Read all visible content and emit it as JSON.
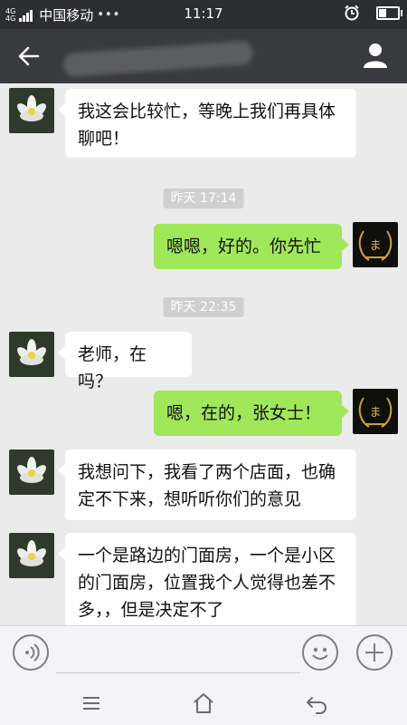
{
  "status_bar": {
    "network_top": "4G",
    "network_bottom": "4G",
    "carrier": "中国移动",
    "dots": "•••",
    "time": "11:17"
  },
  "header": {
    "title": "",
    "back_icon": "arrow-left-icon",
    "profile_icon": "person-icon"
  },
  "messages": [
    {
      "side": "in",
      "text": "我这会比较忙，等晚上我们再具体聊吧！"
    },
    {
      "type": "timestamp",
      "text": "昨天 17:14"
    },
    {
      "side": "out",
      "text": "嗯嗯，好的。你先忙"
    },
    {
      "type": "timestamp",
      "text": "昨天 22:35"
    },
    {
      "side": "in",
      "text": "老师，在吗？"
    },
    {
      "side": "out",
      "text": "嗯，在的，张女士！"
    },
    {
      "side": "in",
      "text": "我想问下，我看了两个店面，也确定不下来，想听听你们的意见"
    },
    {
      "side": "in",
      "text": "一个是路边的门面房，一个是小区的门面房，位置我个人觉得也差不多，，但是决定不了"
    }
  ],
  "colors": {
    "title_bar": "#393a3f",
    "status_bar": "#2d2e32",
    "chat_bg": "#ebebeb",
    "bubble_out": "#a0e75a",
    "bubble_in": "#ffffff"
  },
  "input_bar": {
    "voice_icon": "voice-icon",
    "emoji_icon": "emoji-icon",
    "plus_icon": "plus-icon"
  },
  "nav_bar": {
    "menu_icon": "menu-icon",
    "home_icon": "home-icon",
    "back_icon": "back-icon"
  }
}
